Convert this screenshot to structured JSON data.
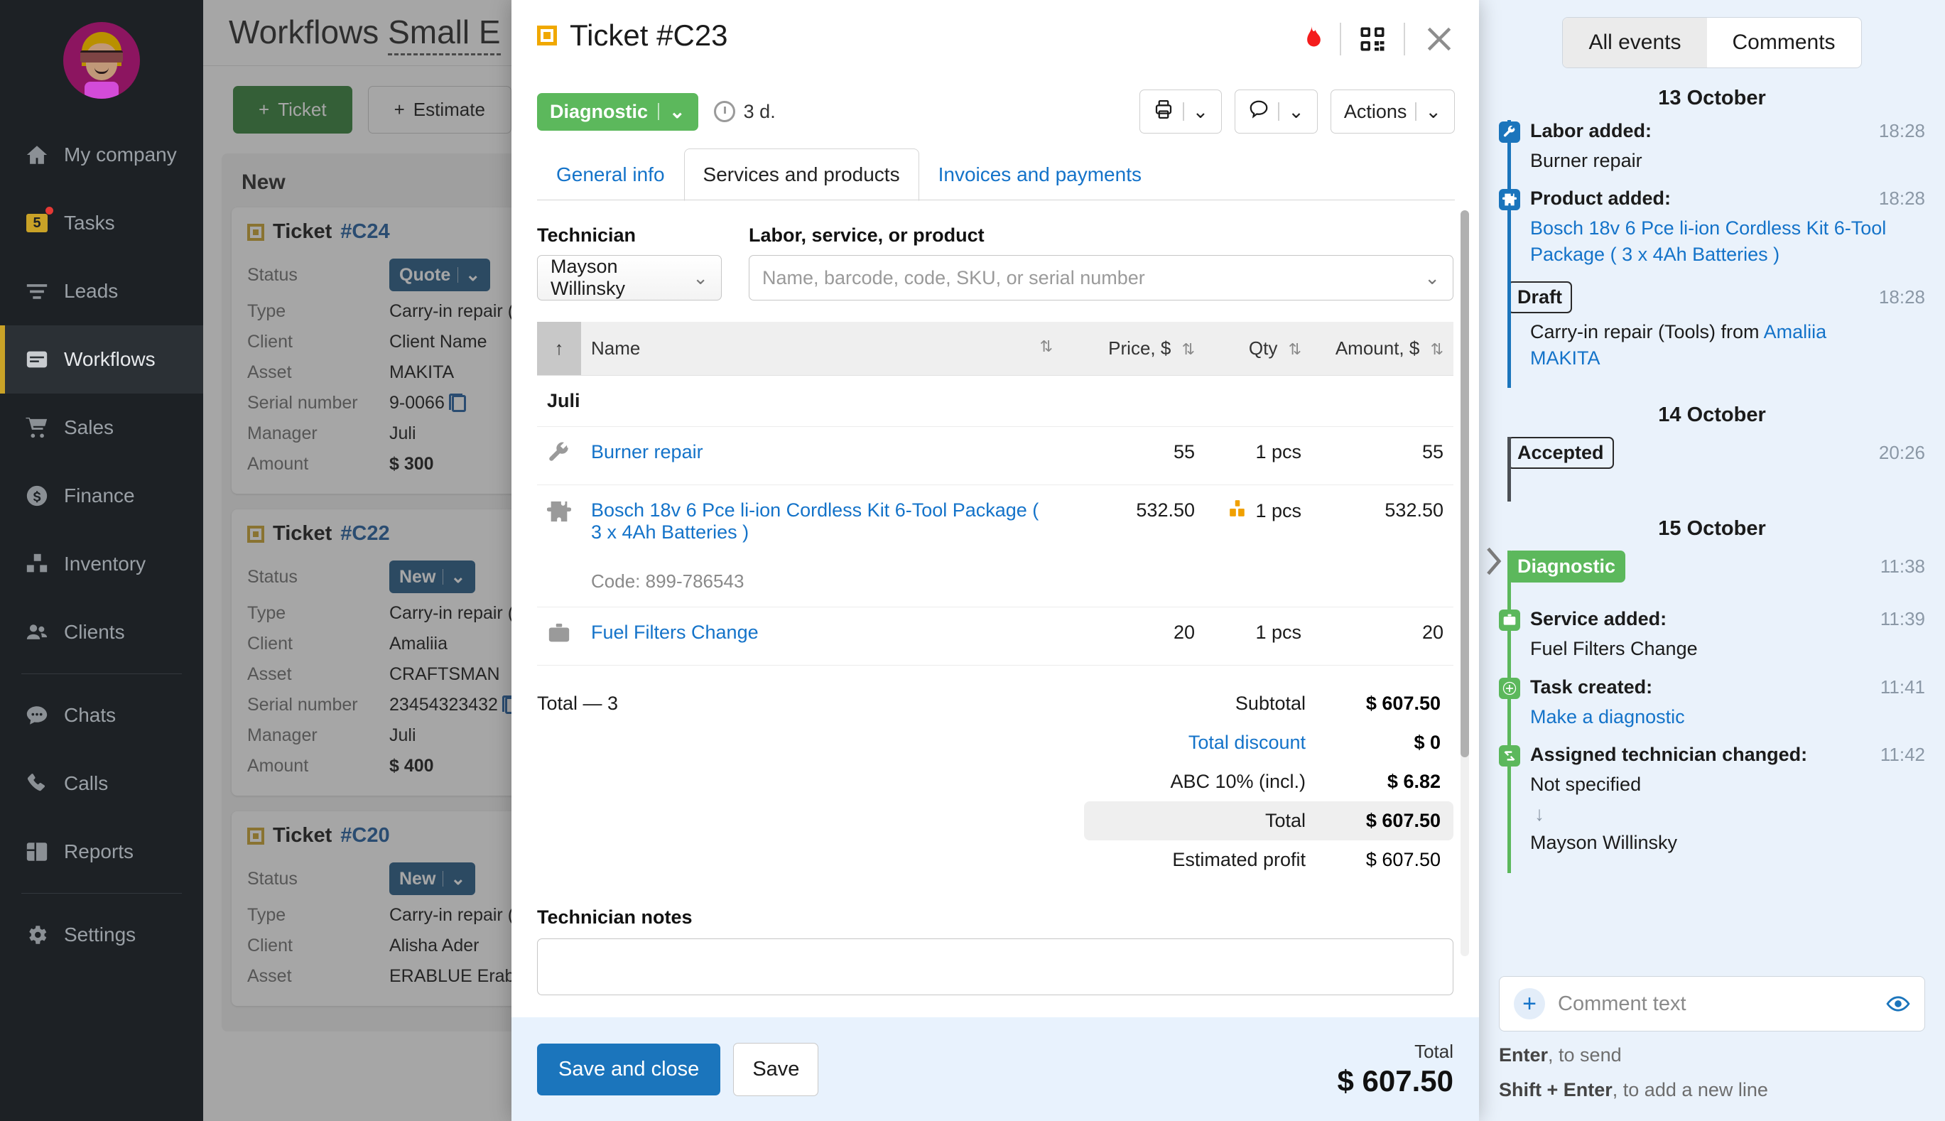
{
  "sidebar": {
    "avatar_name": "user-avatar",
    "items": [
      {
        "label": "My company",
        "icon": "home-icon",
        "active": false
      },
      {
        "label": "Tasks",
        "icon": "tasks-icon",
        "badge": "5",
        "active": false
      },
      {
        "label": "Leads",
        "icon": "leads-funnel-icon",
        "active": false
      },
      {
        "label": "Workflows",
        "icon": "workflows-icon",
        "active": true
      },
      {
        "label": "Sales",
        "icon": "cart-icon",
        "active": false
      },
      {
        "label": "Finance",
        "icon": "dollar-circle-icon",
        "active": false
      },
      {
        "label": "Inventory",
        "icon": "boxes-icon",
        "active": false
      },
      {
        "label": "Clients",
        "icon": "people-icon",
        "active": false
      },
      {
        "label": "Chats",
        "icon": "chat-bubble-icon",
        "active": false
      },
      {
        "label": "Calls",
        "icon": "phone-icon",
        "active": false
      },
      {
        "label": "Reports",
        "icon": "reports-grid-icon",
        "active": false
      },
      {
        "label": "Settings",
        "icon": "gear-icon",
        "active": false
      }
    ]
  },
  "board": {
    "title_main": "Workflows",
    "title_sub": "Small E",
    "add_ticket": "Ticket",
    "add_estimate": "Estimate",
    "column_title": "New",
    "field_labels": {
      "status": "Status",
      "type": "Type",
      "client": "Client",
      "asset": "Asset",
      "serial": "Serial number",
      "manager": "Manager",
      "amount": "Amount"
    },
    "cards": [
      {
        "title": "Ticket",
        "number": "#C24",
        "status": "Quote",
        "type": "Carry-in repair (",
        "client": "Client Name",
        "asset": "MAKITA",
        "serial": "9-0066",
        "manager": "Juli",
        "amount": "$ 300"
      },
      {
        "title": "Ticket",
        "number": "#C22",
        "status": "New",
        "type": "Carry-in repair (",
        "client": "Amaliia",
        "asset": "CRAFTSMAN",
        "serial": "23454323432",
        "manager": "Juli",
        "amount": "$ 400"
      },
      {
        "title": "Ticket",
        "number": "#C20",
        "status": "New",
        "type": "Carry-in repair (",
        "client": "Alisha Ader",
        "asset": "ERABLUE Erablu",
        "serial": "",
        "manager": "",
        "amount": ""
      }
    ]
  },
  "modal": {
    "title": "Ticket #C23",
    "icons": {
      "flame": "flame-icon",
      "qr": "qr-code-icon",
      "close": "close-icon"
    },
    "status_badge": "Diagnostic",
    "duration": "3 d.",
    "actions_label": "Actions",
    "print_icon": "printer-icon",
    "chat_icon": "chat-icon",
    "tabs": [
      {
        "label": "General info",
        "active": false
      },
      {
        "label": "Services and products",
        "active": true
      },
      {
        "label": "Invoices and payments",
        "active": false
      }
    ],
    "technician_label": "Technician",
    "technician_value": "Mayson Willinsky",
    "search_label": "Labor, service, or product",
    "search_placeholder": "Name, barcode, code, SKU, or serial number",
    "table": {
      "columns": [
        "Name",
        "Price, $",
        "Qty",
        "Amount, $"
      ],
      "group": "Juli",
      "rows": [
        {
          "icon": "wrench-icon",
          "name": "Burner repair",
          "price": "55",
          "qty": "1 pcs",
          "amount": "55",
          "code": "",
          "warehouse": false
        },
        {
          "icon": "puzzle-icon",
          "name": "Bosch 18v 6 Pce li-ion Cordless Kit 6-Tool Package ( 3 x 4Ah Batteries )",
          "price": "532.50",
          "qty": "1 pcs",
          "amount": "532.50",
          "code": "Code: 899-786543",
          "warehouse": true
        },
        {
          "icon": "briefcase-icon",
          "name": "Fuel Filters Change",
          "price": "20",
          "qty": "1 pcs",
          "amount": "20",
          "code": "",
          "warehouse": false
        }
      ]
    },
    "totals": {
      "count_label": "Total — 3",
      "subtotal_label": "Subtotal",
      "subtotal_value": "$ 607.50",
      "discount_label": "Total discount",
      "discount_value": "$ 0",
      "tax_label": "ABC 10% (incl.)",
      "tax_value": "$ 6.82",
      "total_label": "Total",
      "total_value": "$ 607.50",
      "profit_label": "Estimated profit",
      "profit_value": "$ 607.50"
    },
    "notes_label": "Technician notes",
    "notes_value": "",
    "footer": {
      "save_close": "Save and close",
      "save": "Save",
      "total_label": "Total",
      "total_value": "$ 607.50"
    }
  },
  "rpanel": {
    "tabs": [
      {
        "label": "All events",
        "active": true
      },
      {
        "label": "Comments",
        "active": false
      }
    ],
    "groups": [
      {
        "date": "13 October",
        "events": [
          {
            "kind": "event",
            "icon": "wrench-icon",
            "color": "#1b75bc",
            "title": "Labor added:",
            "time": "18:28",
            "body": "Burner repair",
            "link": ""
          },
          {
            "kind": "event",
            "icon": "puzzle-icon",
            "color": "#1b75bc",
            "title": "Product added:",
            "time": "18:28",
            "body": "",
            "link": "Bosch 18v 6 Pce li-ion Cordless Kit 6-Tool Package ( 3 x 4Ah Batteries )"
          },
          {
            "kind": "status",
            "chip": "Draft",
            "chip_style": "outline",
            "color": "#1b75bc",
            "time": "18:28",
            "body_pre": "Carry-in repair (Tools) from ",
            "body_link": "Amaliia",
            "body_link2": "MAKITA"
          }
        ]
      },
      {
        "date": "14 October",
        "events": [
          {
            "kind": "status",
            "chip": "Accepted",
            "chip_style": "outline",
            "color": "#4b4f54",
            "time": "20:26",
            "body_pre": "",
            "body_link": "",
            "body_link2": ""
          }
        ]
      },
      {
        "date": "15 October",
        "events": [
          {
            "kind": "status",
            "chip": "Diagnostic",
            "chip_style": "green",
            "color": "#5cb85c",
            "time": "11:38",
            "body_pre": "",
            "body_link": "",
            "body_link2": ""
          },
          {
            "kind": "event",
            "icon": "briefcase-icon",
            "color": "#5cb85c",
            "title": "Service added:",
            "time": "11:39",
            "body": "Fuel Filters Change",
            "link": ""
          },
          {
            "kind": "event",
            "icon": "plus-icon",
            "color": "#5cb85c",
            "title": "Task created:",
            "time": "11:41",
            "body": "",
            "link": "Make a diagnostic"
          },
          {
            "kind": "change",
            "icon": "swap-icon",
            "color": "#5cb85c",
            "title": "Assigned technician changed:",
            "time": "11:42",
            "from": "Not specified",
            "to": "Mayson  Willinsky"
          }
        ]
      }
    ],
    "comment_placeholder": "Comment text",
    "comment_plus": "plus-icon",
    "eye_icon": "eye-icon",
    "hints": [
      {
        "bold": "Enter",
        "rest": ", to send"
      },
      {
        "bold": "Shift + Enter",
        "rest": ", to add a new line"
      }
    ]
  },
  "colors": {
    "sidebar_bg": "#1d2125",
    "accent_blue": "#1473c9",
    "green": "#5cb85c",
    "amber": "#c9a227",
    "panel_bg": "#eaf2fb"
  }
}
